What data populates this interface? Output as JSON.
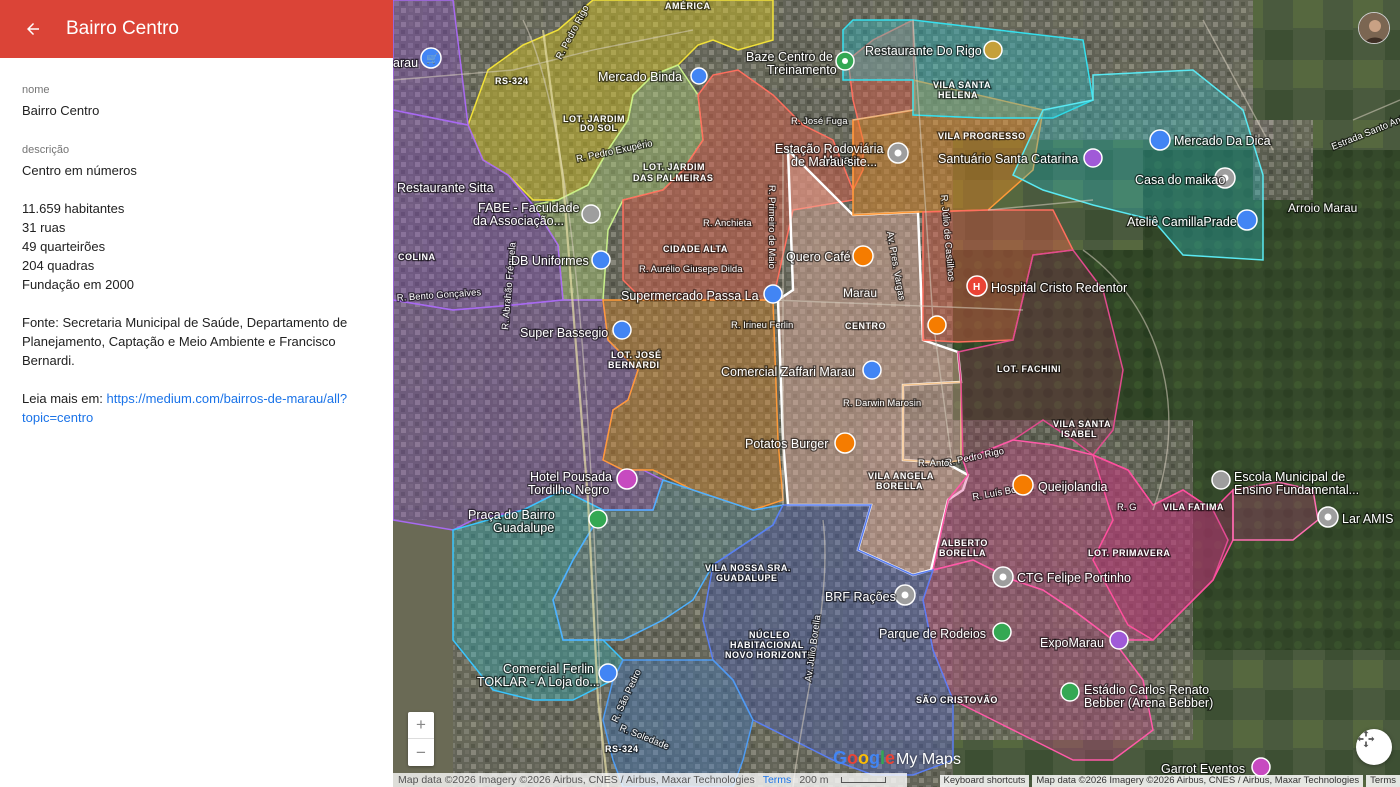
{
  "theme": {
    "header_color": "#db4437",
    "link_color": "#1a73e8",
    "region_colors": {
      "centro": "#f4b8a8",
      "north_yellow": "#e6d21a",
      "orange": "#e8871e",
      "red": "#e0564a",
      "teal": "#1ec9d8",
      "purple": "#8e44e6",
      "blue": "#3a7bd5",
      "magenta": "#d63a8a",
      "green": "#9ed97a"
    }
  },
  "panel": {
    "back_icon": "arrow-back-icon",
    "title": "Bairro Centro",
    "name_label": "nome",
    "name_value": "Bairro Centro",
    "description_label": "descrição",
    "description_title": "Centro em números",
    "stats": [
      "11.659 habitantes",
      "31 ruas",
      "49 quarteirões",
      "204 quadras",
      "Fundação em 2000"
    ],
    "source_line1": "Fonte: Secretaria Municipal de Saúde, Departamento de",
    "source_line2": "Planejamento, Captação e Meio Ambiente e Francisco",
    "source_line3": "Bernardi.",
    "read_more_prefix": "Leia mais em: ",
    "read_more_link_line1": "https://medium.com/bairros-de-marau/all?",
    "read_more_link_line2": "topic=centro"
  },
  "map": {
    "area_labels": [
      {
        "id": "america",
        "text": "AMÉRICA"
      },
      {
        "id": "jardim-sol",
        "text": "LOT. JARDIM"
      },
      {
        "id": "jardim-sol2",
        "text": "DO SOL"
      },
      {
        "id": "jardim-palmeiras",
        "text": "LOT. JARDIM"
      },
      {
        "id": "jardim-palmeiras2",
        "text": "DAS PALMEIRAS"
      },
      {
        "id": "cidade-alta",
        "text": "CIDADE ALTA"
      },
      {
        "id": "centro",
        "text": "CENTRO"
      },
      {
        "id": "vila-santa-helena",
        "text": "VILA SANTA"
      },
      {
        "id": "vila-santa-helena2",
        "text": "HELENA"
      },
      {
        "id": "vila-progresso",
        "text": "VILA PROGRESSO"
      },
      {
        "id": "lot-fachini",
        "text": "LOT. FACHINI"
      },
      {
        "id": "vila-santa-isabel",
        "text": "VILA SANTA"
      },
      {
        "id": "vila-santa-isabel2",
        "text": "ISABEL"
      },
      {
        "id": "vila-fatima",
        "text": "VILA FATIMA"
      },
      {
        "id": "lot-primavera",
        "text": "LOT. PRIMAVERA"
      },
      {
        "id": "vila-angela",
        "text": "VILA ANGELA"
      },
      {
        "id": "vila-angela2",
        "text": "BORELLA"
      },
      {
        "id": "alberto-borella",
        "text": "ALBERTO"
      },
      {
        "id": "alberto-borella2",
        "text": "BORELLA"
      },
      {
        "id": "vila-nossa",
        "text": "VILA NOSSA SRA."
      },
      {
        "id": "vila-nossa2",
        "text": "GUADALUPE"
      },
      {
        "id": "nucleo",
        "text": "NÚCLEO"
      },
      {
        "id": "nucleo2",
        "text": "HABITACIONAL"
      },
      {
        "id": "nucleo3",
        "text": "NOVO HORIZONTE"
      },
      {
        "id": "sao-cristovao",
        "text": "SÃO CRISTOVÃO"
      },
      {
        "id": "colina",
        "text": "COLINA"
      },
      {
        "id": "lot-jose",
        "text": "LOT. JOSÉ"
      },
      {
        "id": "lot-jose2",
        "text": "BERNARDI"
      }
    ],
    "street_labels": [
      {
        "id": "pedro-rigo-n",
        "text": "R. Pedro Rigo"
      },
      {
        "id": "pedro-exuperio",
        "text": "R. Pedro Exupério"
      },
      {
        "id": "anchieta",
        "text": "R. Anchieta"
      },
      {
        "id": "primeiro-maio",
        "text": "R. Primeiro de Maio"
      },
      {
        "id": "jose-fuga",
        "text": "R. José Fuga"
      },
      {
        "id": "irineu-ferlin",
        "text": "R. Irineu Ferlin"
      },
      {
        "id": "darwin",
        "text": "R. Darwin Marosin"
      },
      {
        "id": "pres-vargas",
        "text": "Av. Pres. Vargas"
      },
      {
        "id": "julio-castilhos",
        "text": "R. Júlio de Castilhos"
      },
      {
        "id": "aurelio",
        "text": "R. Aurélio Giusepe Dilda"
      },
      {
        "id": "luis-borton",
        "text": "R. Luís Borton"
      },
      {
        "id": "pedro-rigo-s",
        "text": "R. Pedro Rigo"
      },
      {
        "id": "sao-pedro",
        "text": "R. São Pedro"
      },
      {
        "id": "soledade",
        "text": "R. Soledade"
      },
      {
        "id": "julio-borella",
        "text": "Av. Júlio Borella"
      },
      {
        "id": "abraao",
        "text": "R. Abrahão Fréguela"
      },
      {
        "id": "goncalves",
        "text": "R. Bento Gonçalves"
      },
      {
        "id": "santo-antonio",
        "text": "Estrada Santo Antônio"
      },
      {
        "id": "arroio",
        "text": "Arroio Marau"
      },
      {
        "id": "rs324-n",
        "text": "RS-324"
      },
      {
        "id": "rs324-s",
        "text": "RS-324"
      },
      {
        "id": "marau-site",
        "text": "Marau"
      },
      {
        "id": "r-g",
        "text": "R. G"
      },
      {
        "id": "r-anto",
        "text": "R. Anto"
      }
    ],
    "pois": [
      {
        "id": "arau",
        "text": "arau",
        "icon": "cart-icon",
        "color": "#4285f4"
      },
      {
        "id": "mercado-binda",
        "text": "Mercado Binda",
        "icon": "cart-icon",
        "color": "#4285f4"
      },
      {
        "id": "baze",
        "text": "Baze Centro de",
        "icon": "pin-icon",
        "color": "#34a853"
      },
      {
        "id": "baze2",
        "text": "Treinamento",
        "icon": "",
        "color": ""
      },
      {
        "id": "restaurante-rigo",
        "text": "Restaurante Do Rigo",
        "icon": "fork-knife-icon",
        "color": "#c5a03a"
      },
      {
        "id": "estacao",
        "text": "Estação Rodoviária",
        "icon": "pin-icon",
        "color": "#9e9e9e"
      },
      {
        "id": "estacao2",
        "text": "de Marau site...",
        "icon": "",
        "color": ""
      },
      {
        "id": "santuario",
        "text": "Santuário Santa Catarina",
        "icon": "worship-icon",
        "color": "#a05ad8"
      },
      {
        "id": "mercado-dica",
        "text": "Mercado Da Dica",
        "icon": "cart-icon",
        "color": "#4285f4"
      },
      {
        "id": "casa-maikao",
        "text": "Casa do maikao",
        "icon": "pin-icon",
        "color": "#9e9e9e"
      },
      {
        "id": "atelie",
        "text": "Ateliê CamillaPrade",
        "icon": "bag-icon",
        "color": "#4285f4"
      },
      {
        "id": "restaurante-sitta",
        "text": "Restaurante Sitta",
        "icon": "",
        "color": ""
      },
      {
        "id": "fabe",
        "text": "FABE - Faculdade",
        "icon": "school-icon",
        "color": "#9e9e9e"
      },
      {
        "id": "fabe2",
        "text": "da Associação...",
        "icon": "",
        "color": ""
      },
      {
        "id": "db-uniformes",
        "text": "DB Uniformes",
        "icon": "bag-icon",
        "color": "#4285f4"
      },
      {
        "id": "quero-cafe",
        "text": "Quero Café",
        "icon": "fork-knife-icon",
        "color": "#f57c00"
      },
      {
        "id": "supermercado",
        "text": "Supermercado Passa La",
        "icon": "cart-icon",
        "color": "#4285f4"
      },
      {
        "id": "marau",
        "text": "Marau",
        "icon": "",
        "color": ""
      },
      {
        "id": "hospital",
        "text": "Hospital Cristo Redentor",
        "icon": "hospital-icon",
        "color": "#ea4335"
      },
      {
        "id": "super-bassegio",
        "text": "Super Bassegio",
        "icon": "cart-icon",
        "color": "#4285f4"
      },
      {
        "id": "comercial-zaffari",
        "text": "Comercial Zaffari Marau",
        "icon": "cart-icon",
        "color": "#4285f4"
      },
      {
        "id": "potatos",
        "text": "Potatos Burger",
        "icon": "fork-knife-icon",
        "color": "#f57c00"
      },
      {
        "id": "escola",
        "text": "Escola Municipal de",
        "icon": "school-icon",
        "color": "#9e9e9e"
      },
      {
        "id": "escola2",
        "text": "Ensino Fundamental...",
        "icon": "",
        "color": ""
      },
      {
        "id": "queijolandia",
        "text": "Queijolandia",
        "icon": "fork-knife-icon",
        "color": "#f57c00"
      },
      {
        "id": "lar-amis",
        "text": "Lar AMIS",
        "icon": "pin-icon",
        "color": "#9e9e9e"
      },
      {
        "id": "hotel",
        "text": "Hotel Pousada",
        "icon": "bed-icon",
        "color": "#c74ac0"
      },
      {
        "id": "hotel2",
        "text": "Tordilho Negro",
        "icon": "",
        "color": ""
      },
      {
        "id": "praca",
        "text": "Praça do Bairro",
        "icon": "tree-icon",
        "color": "#34a853"
      },
      {
        "id": "praca2",
        "text": "Guadalupe",
        "icon": "",
        "color": ""
      },
      {
        "id": "ctg",
        "text": "CTG Felipe Portinho",
        "icon": "pin-icon",
        "color": "#9e9e9e"
      },
      {
        "id": "brf",
        "text": "BRF Rações",
        "icon": "pin-icon",
        "color": "#9e9e9e"
      },
      {
        "id": "parque",
        "text": "Parque de Rodeios",
        "icon": "tree-icon",
        "color": "#34a853"
      },
      {
        "id": "expomarau",
        "text": "ExpoMarau",
        "icon": "theater-icon",
        "color": "#a05ad8"
      },
      {
        "id": "comercial-ferlin",
        "text": "Comercial Ferlin",
        "icon": "bag-icon",
        "color": "#4285f4"
      },
      {
        "id": "toklar",
        "text": "TOKLAR - A Loja do...",
        "icon": "",
        "color": ""
      },
      {
        "id": "estadio",
        "text": "Estádio Carlos Renato",
        "icon": "stadium-icon",
        "color": "#34a853"
      },
      {
        "id": "estadio2",
        "text": "Bebber (Arena Bebber)",
        "icon": "",
        "color": ""
      },
      {
        "id": "garrot",
        "text": "Garrot Eventos",
        "icon": "bed-icon",
        "color": "#c74ac0"
      }
    ],
    "controls": {
      "zoom_in": "+",
      "zoom_out": "−",
      "recenter_icon": "fullscreen-icon"
    },
    "logo": {
      "google": "Google",
      "my_maps": "My Maps"
    },
    "footer_left": {
      "attribution": "Map data ©2026 Imagery ©2026 Airbus, CNES / Airbus, Maxar Technologies",
      "terms": "Terms",
      "scale": "200 m"
    },
    "footer_right": {
      "shortcuts": "Keyboard shortcuts",
      "attribution": "Map data ©2026 Imagery ©2026 Airbus, CNES / Airbus, Maxar Technologies",
      "terms": "Terms"
    }
  }
}
